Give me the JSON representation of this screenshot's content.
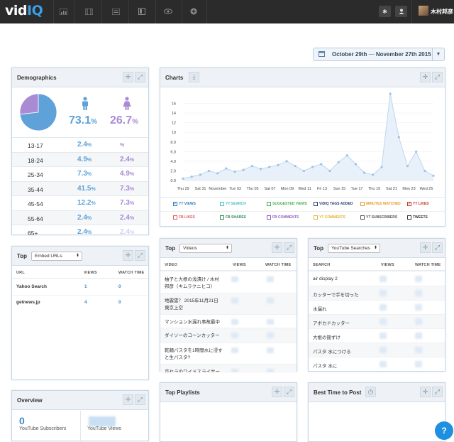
{
  "app": {
    "logo_text": "vid",
    "logo_accent": "IQ",
    "username": "木村邦彦"
  },
  "nav": {
    "icons": [
      "bar-chart-icon",
      "film-icon",
      "list-icon",
      "book-icon",
      "eye-icon",
      "plus-circle-icon"
    ]
  },
  "date_range": {
    "start": "October 29th",
    "sep": "—",
    "end": "November 27th 2015"
  },
  "demographics": {
    "title": "Demographics",
    "male_pct": "73.1",
    "female_pct": "26.7",
    "pct_sign": "%",
    "rows": [
      {
        "age": "13-17",
        "male": "2.4",
        "female": ""
      },
      {
        "age": "18-24",
        "male": "4.9",
        "female": "2.4"
      },
      {
        "age": "25-34",
        "male": "7.3",
        "female": "4.9"
      },
      {
        "age": "35-44",
        "male": "41.5",
        "female": "7.3"
      },
      {
        "age": "45-54",
        "male": "12.2",
        "female": "7.3"
      },
      {
        "age": "55-64",
        "male": "2.4",
        "female": "2.4"
      },
      {
        "age": "65+",
        "male": "2.4",
        "female": "2.4"
      }
    ],
    "pie": {
      "male": 73.1,
      "female": 26.7,
      "male_color": "#5fa2d9",
      "female_color": "#a98bd3"
    }
  },
  "charts": {
    "title": "Charts",
    "legend_row1": [
      {
        "label": "YT VIEWS",
        "color": "#2f7fc1",
        "checked": true
      },
      {
        "label": "YT SEARCH",
        "color": "#4cc0c0",
        "checked": false
      },
      {
        "label": "SUGGESTED VIEWS",
        "color": "#4caf50",
        "checked": false
      },
      {
        "label": "VIDIQ TAGS ADDED",
        "color": "#2c3e77",
        "checked": false
      },
      {
        "label": "MINUTES WATCHED",
        "color": "#e89a2c",
        "checked": false
      },
      {
        "label": "YT LIKES",
        "color": "#c0392b",
        "checked": true
      }
    ],
    "legend_row2": [
      {
        "label": "FB LIKES",
        "color": "#e05a5a",
        "checked": false
      },
      {
        "label": "FB SHARES",
        "color": "#2e8b57",
        "checked": false
      },
      {
        "label": "FB COMMENTS",
        "color": "#8e5bc4",
        "checked": false
      },
      {
        "label": "YT COMMENTS",
        "color": "#e6b32a",
        "checked": false
      },
      {
        "label": "YT SUBSCRIBERS",
        "color": "#555555",
        "checked": false
      },
      {
        "label": "TWEETS",
        "color": "#333333",
        "checked": false
      }
    ]
  },
  "chart_data": {
    "type": "line",
    "title": "",
    "xlabel": "",
    "ylabel": "",
    "x": [
      "Thu 29",
      "Sat 31",
      "November",
      "Tue 03",
      "Thu 05",
      "Sat 07",
      "Mon 09",
      "Wed 11",
      "Fri 13",
      "Sun 15",
      "Tue 17",
      "Thu 19",
      "Sat 21",
      "Mon 23",
      "Wed 25"
    ],
    "y_ticks": [
      "0.0",
      "2.0",
      "4.0",
      "6.0",
      "8.0",
      "10",
      "12",
      "14",
      "16"
    ],
    "ylim": [
      0,
      18
    ],
    "series": [
      {
        "values": [
          0.4,
          0.8,
          1.2,
          2.0,
          1.5,
          2.5,
          1.8,
          2.2,
          3.0,
          2.4,
          2.8,
          3.2,
          4.0,
          3.0,
          2.0,
          2.8,
          3.4,
          2.0,
          3.8,
          5.2,
          3.4,
          1.6,
          1.2,
          2.8,
          18.0,
          9.0,
          3.0,
          6.0,
          2.0,
          1.0
        ]
      }
    ]
  },
  "top_embed": {
    "title": "Top",
    "select": "Embed URLs",
    "columns": [
      "URL",
      "VIEWS",
      "WATCH TIME"
    ],
    "rows": [
      {
        "url": "Yahoo Search",
        "views": "1",
        "watch": "0"
      },
      {
        "url": "getnews.jp",
        "views": "4",
        "watch": "0"
      }
    ]
  },
  "top_videos": {
    "title": "Top",
    "select": "Videos",
    "columns": [
      "VIDEO",
      "VIEWS",
      "WATCH TIME"
    ],
    "rows": [
      {
        "line1": "柚子と大根の浅漬け / 木村",
        "line2": "邦彦（キムラクニヒコ）"
      },
      {
        "line1": "地震雲？ 2015年11月21日",
        "line2": "東京上空"
      },
      {
        "line1": "マンション水漏れ事故最中",
        "line2": ""
      },
      {
        "line1": "ダイソーのコーンカッター",
        "line2": ""
      },
      {
        "line1": "乾麺パスタを1時間水に浸す",
        "line2": "と生パスタ?"
      },
      {
        "line1": "京セラのワイドスライサー",
        "line2": ""
      }
    ]
  },
  "top_searches": {
    "title": "Top",
    "select": "YouTube Searches",
    "columns": [
      "SEARCH",
      "VIEWS",
      "WATCH TIME"
    ],
    "rows": [
      "air display 2",
      "カッターで手を切った",
      "水漏れ",
      "アボカドカッター",
      "大根の簡ずけ",
      "パスタ 水につける",
      "パスタ 水に"
    ]
  },
  "overview": {
    "title": "Overview",
    "subscribers_value": "0",
    "subscribers_label": "YouTube Subscribers",
    "views_label": "YouTube Views"
  },
  "top_playlists": {
    "title": "Top Playlists"
  },
  "best_time": {
    "title": "Best Time to Post"
  },
  "help": {
    "label": "?"
  }
}
